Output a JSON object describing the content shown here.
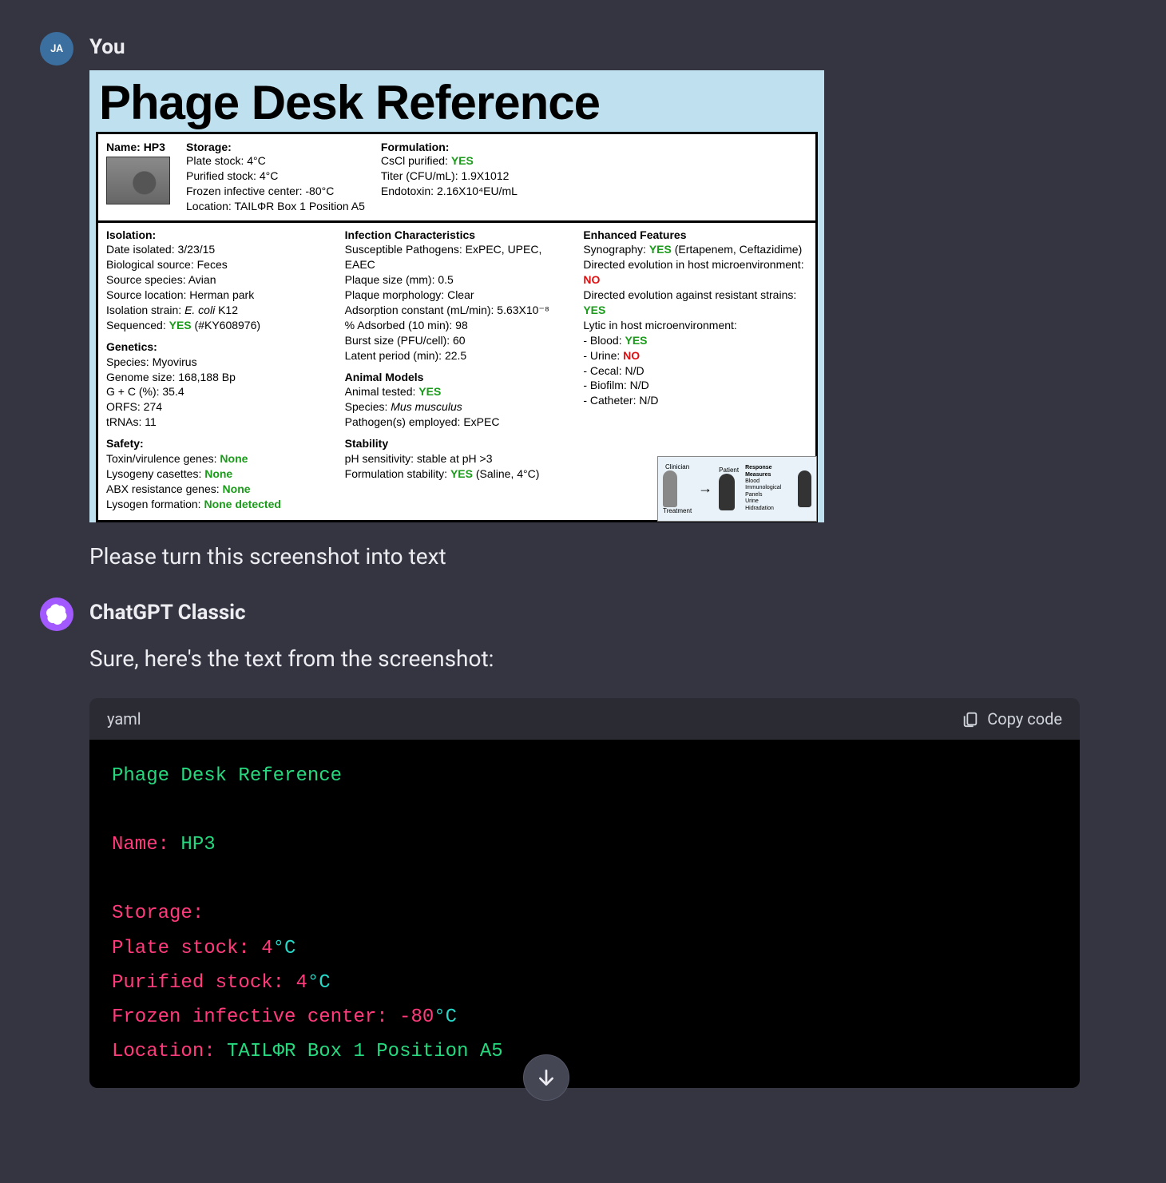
{
  "user": {
    "avatar_initials": "JA",
    "sender_label": "You",
    "prompt_text": "Please turn this screenshot into text"
  },
  "assistant": {
    "sender_label": "ChatGPT Classic",
    "intro_text": "Sure, here's the text from the screenshot:"
  },
  "screenshot": {
    "title": "Phage Desk Reference",
    "name_label": "Name:",
    "name_value": "HP3",
    "storage": {
      "heading": "Storage:",
      "plate_stock": "Plate stock: 4°C",
      "purified_stock": "Purified stock: 4°C",
      "frozen": "Frozen infective center: -80°C",
      "location": "Location: TAILΦR Box 1 Position A5"
    },
    "formulation": {
      "heading": "Formulation:",
      "cscl_label": "CsCl purified:",
      "cscl_val": "YES",
      "titer": "Titer (CFU/mL): 1.9X1012",
      "endotoxin": "Endotoxin: 2.16X10⁴EU/mL"
    },
    "isolation": {
      "heading": "Isolation:",
      "date": "Date isolated: 3/23/15",
      "bio": "Biological source: Feces",
      "species": "Source species: Avian",
      "loc": "Source location: Herman park",
      "iso_strain_label": "Isolation strain:",
      "iso_strain_ital": "E. coli",
      "iso_strain_suffix": " K12",
      "seq_label": "Sequenced:",
      "seq_val": "YES",
      "seq_suffix": " (#KY608976)"
    },
    "genetics": {
      "heading": "Genetics:",
      "species": "Species: Myovirus",
      "genome": "Genome size: 168,188 Bp",
      "gc": "G + C (%): 35.4",
      "orfs": "ORFS: 274",
      "trnas": "tRNAs: 11"
    },
    "safety": {
      "heading": "Safety:",
      "toxin_label": "Toxin/virulence genes:",
      "toxin_val": "None",
      "lys_label": "Lysogeny casettes:",
      "lys_val": "None",
      "abx_label": "ABX resistance genes:",
      "abx_val": "None",
      "lysform_label": "Lysogen formation:",
      "lysform_val": "None detected"
    },
    "infection": {
      "heading": "Infection Characteristics",
      "susc": "Susceptible Pathogens: ExPEC, UPEC, EAEC",
      "plaque_size": "Plaque size (mm): 0.5",
      "plaque_morph": "Plaque morphology: Clear",
      "adsorption": "Adsorption constant (mL/min): 5.63X10⁻⁸",
      "pct_adsorbed": "% Adsorbed (10 min): 98",
      "burst": "Burst size (PFU/cell): 60",
      "latent": "Latent period (min): 22.5"
    },
    "animal": {
      "heading": "Animal Models",
      "tested_label": "Animal tested:",
      "tested_val": "YES",
      "species_label": "Species:",
      "species_ital": "Mus musculus",
      "pathogens": "Pathogen(s) employed: ExPEC"
    },
    "stability": {
      "heading": "Stability",
      "ph": "pH sensitivity: stable at pH >3",
      "form_label": "Formulation stability:",
      "form_val": "YES",
      "form_suffix": " (Saline, 4°C)"
    },
    "enhanced": {
      "heading": "Enhanced Features",
      "syn_label": "Synography:",
      "syn_val": "YES",
      "syn_suffix": " (Ertapenem, Ceftazidime)",
      "de_host_label": "Directed evolution in host microenvironment:",
      "de_host_val": "NO",
      "de_res_label": "Directed evolution against resistant strains:",
      "de_res_val": "YES",
      "lytic_label": "Lytic in host microenvironment:",
      "blood_label": "- Blood:",
      "blood_val": "YES",
      "urine_label": "- Urine:",
      "urine_val": "NO",
      "cecal": "- Cecal: N/D",
      "biofilm": "- Biofilm: N/D",
      "catheter": "- Catheter: N/D"
    },
    "inset": {
      "clinician": "Clinician",
      "patient": "Patient",
      "measures": "Response Measures",
      "treatment": "Treatment",
      "m1": "Blood",
      "m2": "Immunological Panels",
      "m3": "Urine",
      "m4": "Hidradation"
    }
  },
  "codeblock": {
    "lang_label": "yaml",
    "copy_label": "Copy code",
    "lines": {
      "l1": "Phage Desk Reference",
      "l2_key": "Name:",
      "l2_val": " HP3",
      "l3": "Storage:",
      "l4_key": "Plate stock:",
      "l4_num": " 4",
      "l4_unit": "°C",
      "l5_key": "Purified stock:",
      "l5_num": " 4",
      "l5_unit": "°C",
      "l6_key": "Frozen infective center:",
      "l6_num": " -80",
      "l6_unit": "°C",
      "l7_key": "Location:",
      "l7_val": " TAILΦR Box 1 Position A5"
    }
  },
  "scroll_button_label": "Scroll down"
}
